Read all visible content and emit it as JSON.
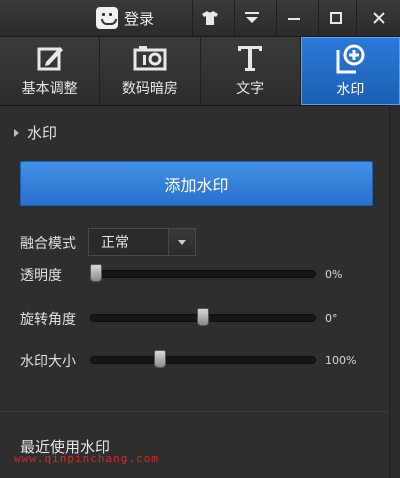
{
  "titlebar": {
    "login_label": "登录",
    "buttons": [
      {
        "name": "skin-button",
        "icon": "tshirt-icon"
      },
      {
        "name": "menu-button",
        "icon": "dropdown-icon"
      },
      {
        "name": "minimize-button",
        "icon": "minimize-icon"
      },
      {
        "name": "maximize-button",
        "icon": "maximize-icon"
      },
      {
        "name": "close-button",
        "icon": "close-icon"
      }
    ]
  },
  "tabs": [
    {
      "label": "基本调整",
      "icon": "edit-icon",
      "active": false
    },
    {
      "label": "数码暗房",
      "icon": "camera-icon",
      "active": false
    },
    {
      "label": "文字",
      "icon": "text-icon",
      "active": false
    },
    {
      "label": "水印",
      "icon": "watermark-add-icon",
      "active": true
    }
  ],
  "section": {
    "title": "水印"
  },
  "add_button": {
    "label": "添加水印"
  },
  "blend": {
    "label": "融合模式",
    "value": "正常"
  },
  "sliders": [
    {
      "label": "透明度",
      "value_text": "0%",
      "fraction": 0.0
    },
    {
      "label": "旋转角度",
      "value_text": "0°",
      "fraction": 0.5
    },
    {
      "label": "水印大小",
      "value_text": "100%",
      "fraction": 0.3
    }
  ],
  "recent": {
    "title": "最近使用水印"
  },
  "overlay_watermark": "www.qinpinchang.com",
  "colors": {
    "accent": "#2a7ad8",
    "background": "#2e2e2e",
    "watermark_text": "#d32a2a"
  }
}
